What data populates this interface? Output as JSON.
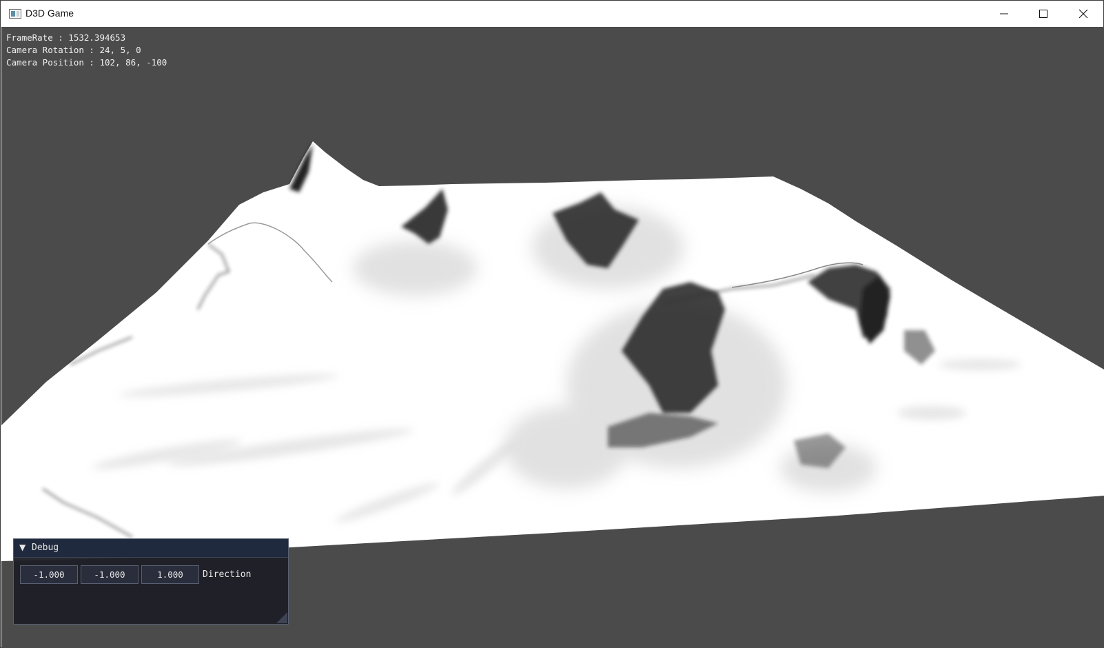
{
  "window": {
    "title": "D3D Game",
    "app_icon": "window-app-icon",
    "controls": [
      "minimize-icon",
      "maximize-icon",
      "close-icon"
    ]
  },
  "hud": {
    "framerate": "FrameRate : 1532.394653",
    "camera_rotation": "Camera Rotation : 24, 5, 0",
    "camera_position": "Camera Position : 102, 86, -100"
  },
  "debug": {
    "title": "Debug",
    "collapse_icon": "triangle-down-icon",
    "direction": {
      "x": "-1.000",
      "y": "-1.000",
      "z": "1.000",
      "label": "Direction"
    }
  },
  "colors": {
    "background": "#4b4b4b",
    "terrain": "#ffffff",
    "panel_bg": "#1e1f26",
    "panel_header": "#1f2a3e"
  }
}
